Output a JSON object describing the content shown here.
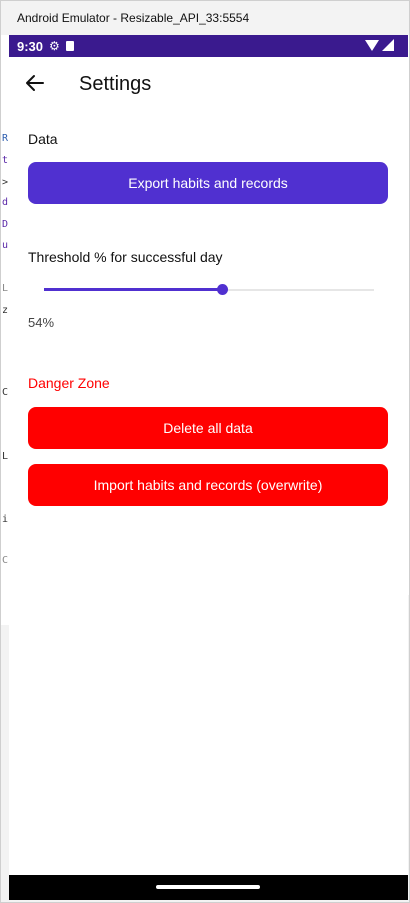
{
  "window": {
    "title": "Android Emulator - Resizable_API_33:5554"
  },
  "statusbar": {
    "time": "9:30",
    "icons": [
      "gear-icon",
      "sd-card-icon",
      "wifi-icon",
      "signal-icon"
    ]
  },
  "appbar": {
    "title": "Settings",
    "back_icon": "arrow-left-icon"
  },
  "data_section": {
    "label": "Data",
    "export_button": "Export habits and records"
  },
  "threshold": {
    "label": "Threshold % for successful day",
    "value": 54,
    "value_text": "54%"
  },
  "danger_zone": {
    "label": "Danger Zone",
    "delete_button": "Delete all data",
    "import_button": "Import habits and records (overwrite)"
  },
  "colors": {
    "primary": "#5030d0",
    "danger": "#ff0000",
    "statusbar": "#3a1a8e"
  }
}
